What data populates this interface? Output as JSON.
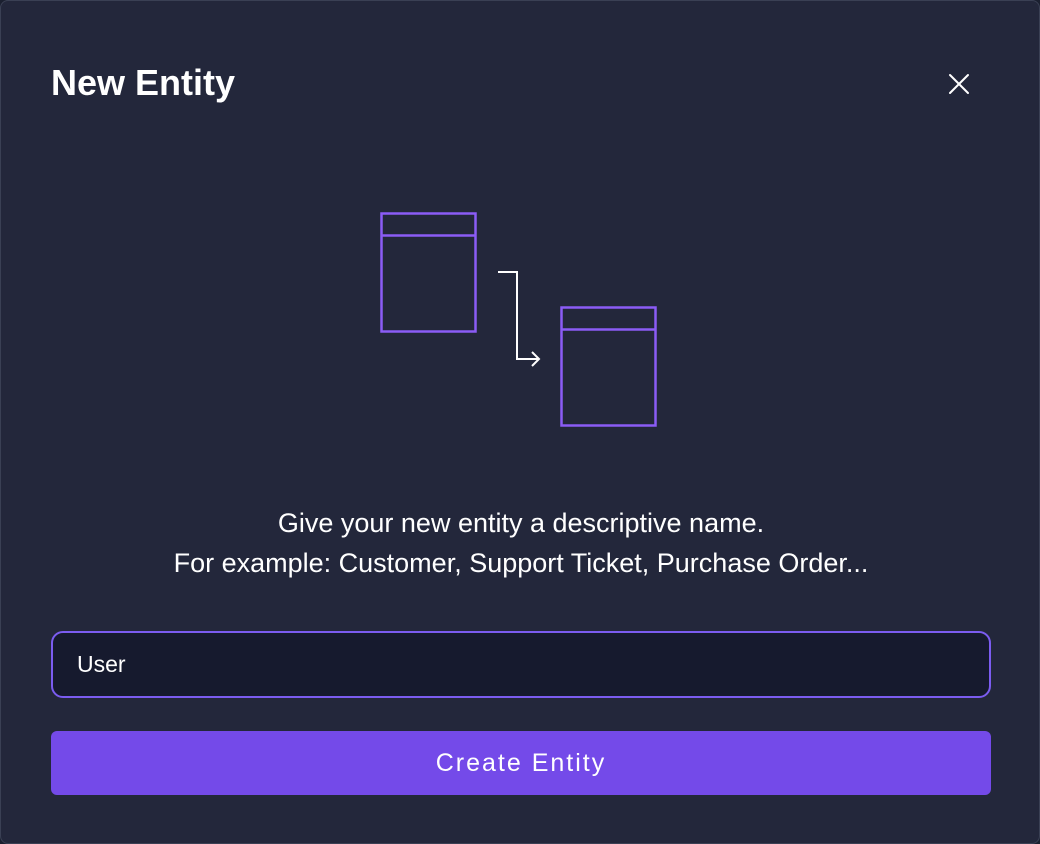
{
  "dialog": {
    "title": "New Entity",
    "close_icon": "close-icon",
    "illustration_icon": "entity-relation-illustration",
    "description_line1": "Give your new entity a descriptive name.",
    "description_line2": "For example: Customer, Support Ticket, Purchase Order...",
    "input_value": "User",
    "button_label": "Create Entity"
  },
  "colors": {
    "background": "#23273b",
    "accent": "#744ae9",
    "input_border": "#7b5cf0",
    "input_bg": "#161a2e",
    "text": "#ffffff"
  }
}
